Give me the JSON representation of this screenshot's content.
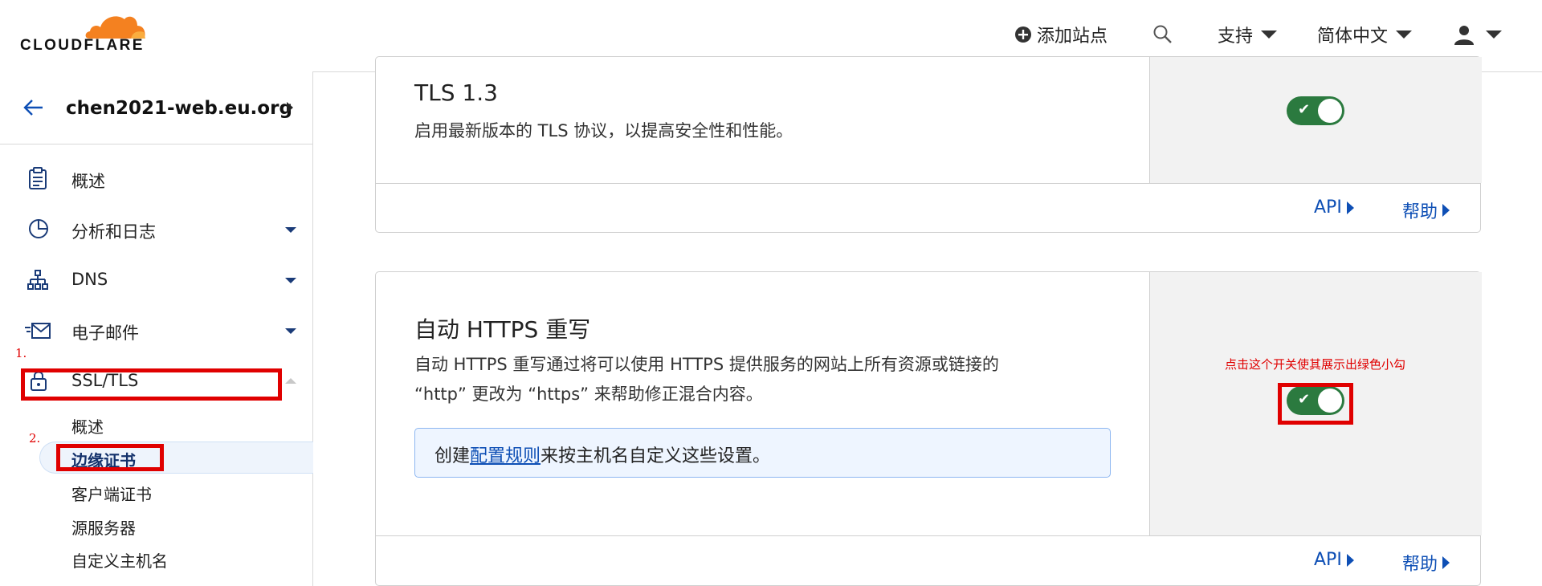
{
  "header": {
    "logo_text": "CLOUDFLARE",
    "add_site": "添加站点",
    "support": "支持",
    "language": "简体中文"
  },
  "sidebar": {
    "zone": "chen2021-web.eu.org",
    "items": [
      {
        "label": "概述",
        "icon": "clipboard-icon"
      },
      {
        "label": "分析和日志",
        "icon": "pie-chart-icon"
      },
      {
        "label": "DNS",
        "icon": "network-icon"
      },
      {
        "label": "电子邮件",
        "icon": "mail-icon"
      },
      {
        "label": "SSL/TLS",
        "icon": "lock-icon"
      }
    ],
    "ssl_sub": [
      "概述",
      "边缘证书",
      "客户端证书",
      "源服务器",
      "自定义主机名"
    ],
    "annotations": {
      "one": "1.",
      "two": "2."
    }
  },
  "cards": {
    "tls13": {
      "title": "TLS 1.3",
      "desc": "启用最新版本的 TLS 协议，以提高安全性和性能。",
      "api": "API",
      "help": "帮助",
      "enabled": true
    },
    "https_rewrite": {
      "title": "自动 HTTPS 重写",
      "desc_line1": "自动 HTTPS 重写通过将可以使用 HTTPS 提供服务的网站上所有资源或链接的",
      "desc_line2": "“http” 更改为 “https” 来帮助修正混合内容。",
      "info_prefix": "创建",
      "info_link": "配置规则",
      "info_suffix": "来按主机名自定义这些设置。",
      "annotation": "点击这个开关使其展示出绿色小勾",
      "api": "API",
      "help": "帮助",
      "enabled": true
    }
  },
  "colors": {
    "brand_orange": "#f48120",
    "link_blue": "#0e4fb5",
    "toggle_green": "#2b7a3f",
    "annotation_red": "#e00000"
  }
}
